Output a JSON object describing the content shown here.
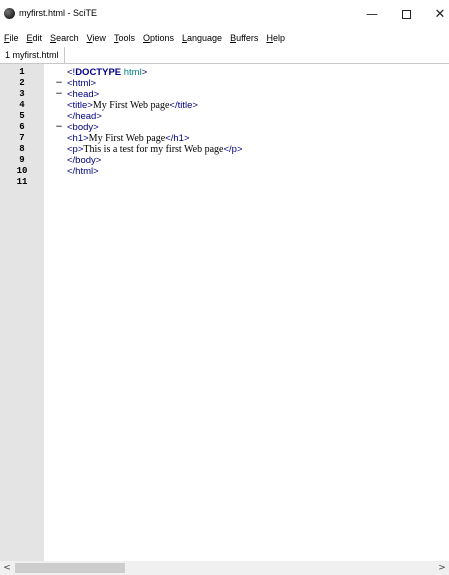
{
  "window": {
    "title": "myfirst.html - SciTE"
  },
  "controls": {
    "minimize": "—",
    "maximize": "",
    "close": "✕"
  },
  "menu": [
    {
      "key": "F",
      "rest": "ile"
    },
    {
      "key": "E",
      "rest": "dit"
    },
    {
      "key": "S",
      "rest": "earch"
    },
    {
      "key": "V",
      "rest": "iew"
    },
    {
      "key": "T",
      "rest": "ools"
    },
    {
      "key": "O",
      "rest": "ptions"
    },
    {
      "key": "L",
      "rest": "anguage"
    },
    {
      "key": "B",
      "rest": "uffers"
    },
    {
      "key": "H",
      "rest": "elp"
    }
  ],
  "tabs": [
    {
      "label": "1 myfirst.html"
    }
  ],
  "editor": {
    "lines": [
      {
        "num": "1",
        "fold": "",
        "parts": [
          {
            "t": "<!",
            "c": "tag"
          },
          {
            "t": "DOCTYPE",
            "c": "doctype"
          },
          {
            "t": " html",
            "c": "dtname"
          },
          {
            "t": ">",
            "c": "tag"
          }
        ]
      },
      {
        "num": "2",
        "fold": "−",
        "parts": [
          {
            "t": "<html>",
            "c": "tag"
          }
        ]
      },
      {
        "num": "3",
        "fold": "−",
        "parts": [
          {
            "t": "<head>",
            "c": "tag"
          }
        ]
      },
      {
        "num": "4",
        "fold": "",
        "parts": [
          {
            "t": "<title>",
            "c": "tag"
          },
          {
            "t": "My First Web page",
            "c": "txt"
          },
          {
            "t": "</title>",
            "c": "tag"
          }
        ]
      },
      {
        "num": "5",
        "fold": "",
        "parts": [
          {
            "t": "</head>",
            "c": "tag"
          }
        ]
      },
      {
        "num": "6",
        "fold": "−",
        "parts": [
          {
            "t": "<body>",
            "c": "tag"
          }
        ]
      },
      {
        "num": "7",
        "fold": "",
        "parts": [
          {
            "t": "<h1>",
            "c": "tag"
          },
          {
            "t": "My First Web page",
            "c": "txt"
          },
          {
            "t": "</h1>",
            "c": "tag"
          }
        ]
      },
      {
        "num": "8",
        "fold": "",
        "parts": [
          {
            "t": "<p>",
            "c": "tag"
          },
          {
            "t": "This is a test for my first Web page",
            "c": "txt"
          },
          {
            "t": "</p>",
            "c": "tag"
          }
        ]
      },
      {
        "num": "9",
        "fold": "",
        "parts": [
          {
            "t": "</body>",
            "c": "tag"
          }
        ]
      },
      {
        "num": "10",
        "fold": "",
        "parts": [
          {
            "t": "</html>",
            "c": "tag"
          }
        ]
      },
      {
        "num": "11",
        "fold": "",
        "parts": []
      }
    ]
  },
  "scrollbar": {
    "left_arrow": "<",
    "right_arrow": ">"
  },
  "colors": {
    "tag": "#000080",
    "doctype": "#00008b",
    "doctype_name": "#008080",
    "gutter": "#e4e4e4"
  },
  "icons": {
    "app": "scite-app-icon"
  }
}
